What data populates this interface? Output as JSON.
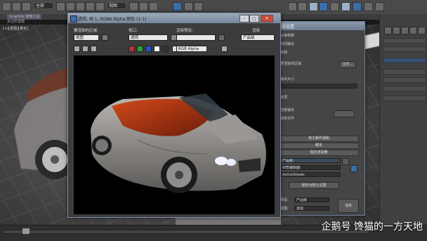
{
  "toolbar": {
    "dropdown_all": "全部",
    "dropdown_view": "视图"
  },
  "ribbon": {
    "tab": "Graphite 建模工具",
    "sub": "多边形建模"
  },
  "viewport": {
    "label": "[+][透视][真实]"
  },
  "render_window": {
    "title": "透视, 帧 1, RGBA Alpha 颜色 (1:1)",
    "area_label": "要渲染的区域:",
    "area_value": "视图",
    "viewport_label": "视口:",
    "viewport_value": "透视",
    "preset_label": "渲染预设:",
    "render_btn": "渲染",
    "production_value": "产品级",
    "channel_value": "RGB Alpha",
    "close_glyph": "✕"
  },
  "setup_window": {
    "title": "渲染设置",
    "lines": [
      "公用参数",
      "时间输出",
      "单帧",
      "要渲染的区域",
      "输出大小",
      "选项",
      "渲染输出",
      "保存文件",
      "文件..."
    ],
    "sections": [
      "公用参数",
      "电子邮件通知",
      "脚本",
      "指定渲染器"
    ],
    "renderer_rows": [
      "产品级:",
      "材质编辑器:",
      "ActiveShade:"
    ],
    "save_default_btn": "保存为默认设置",
    "view_label": "视图:",
    "view_value": "透视",
    "render_btn": "渲染",
    "preset_label": "预设:",
    "preset_value": "产品级"
  },
  "watermark": "企鹅号 馋猫的一方天地"
}
